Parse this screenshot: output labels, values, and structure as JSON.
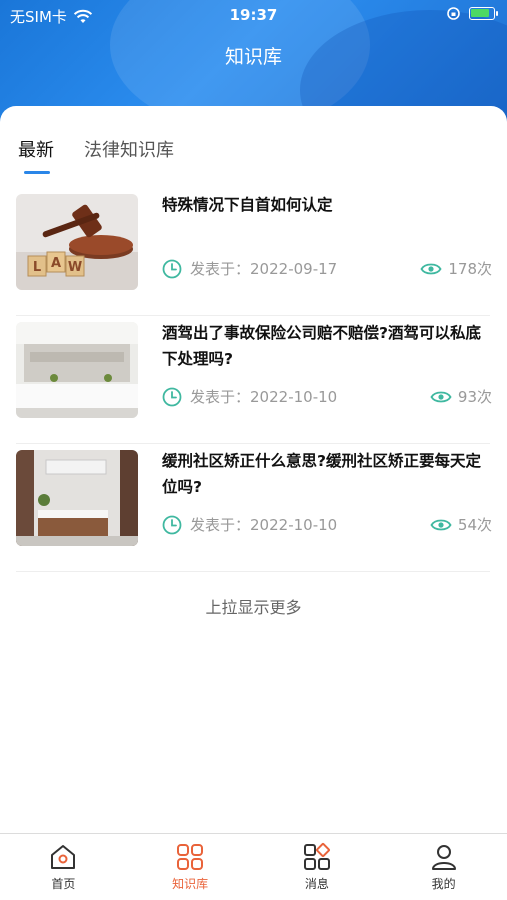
{
  "status_bar": {
    "carrier": "无SIM卡",
    "time": "19:37",
    "battery_level": 0.85
  },
  "nav": {
    "title": "知识库"
  },
  "tabs": [
    {
      "label": "最新",
      "active": true
    },
    {
      "label": "法律知识库",
      "active": false
    }
  ],
  "articles": [
    {
      "title": "特殊情况下自首如何认定",
      "date_prefix": "发表于：",
      "date": "2022-09-17",
      "views": "178次",
      "image": "gavel-law-photo"
    },
    {
      "title": "酒驾出了事故保险公司赔不赔偿?酒驾可以私底下处理吗?",
      "date_prefix": "发表于：",
      "date": "2022-10-10",
      "views": "93次",
      "image": "office-reception-photo"
    },
    {
      "title": "缓刑社区矫正什么意思?缓刑社区矫正要每天定位吗?",
      "date_prefix": "发表于：",
      "date": "2022-10-10",
      "views": "54次",
      "image": "office-desk-photo"
    }
  ],
  "load_more": "上拉显示更多",
  "tabbar": [
    {
      "label": "首页",
      "icon": "home-icon",
      "active": false
    },
    {
      "label": "知识库",
      "icon": "grid-icon",
      "active": true
    },
    {
      "label": "消息",
      "icon": "message-grid-icon",
      "active": false
    },
    {
      "label": "我的",
      "icon": "user-icon",
      "active": false
    }
  ],
  "colors": {
    "header": "#1a76d8",
    "accent": "#e9633a",
    "meta_icon": "#3fb8a0",
    "tab_indicator": "#2a86e8"
  }
}
